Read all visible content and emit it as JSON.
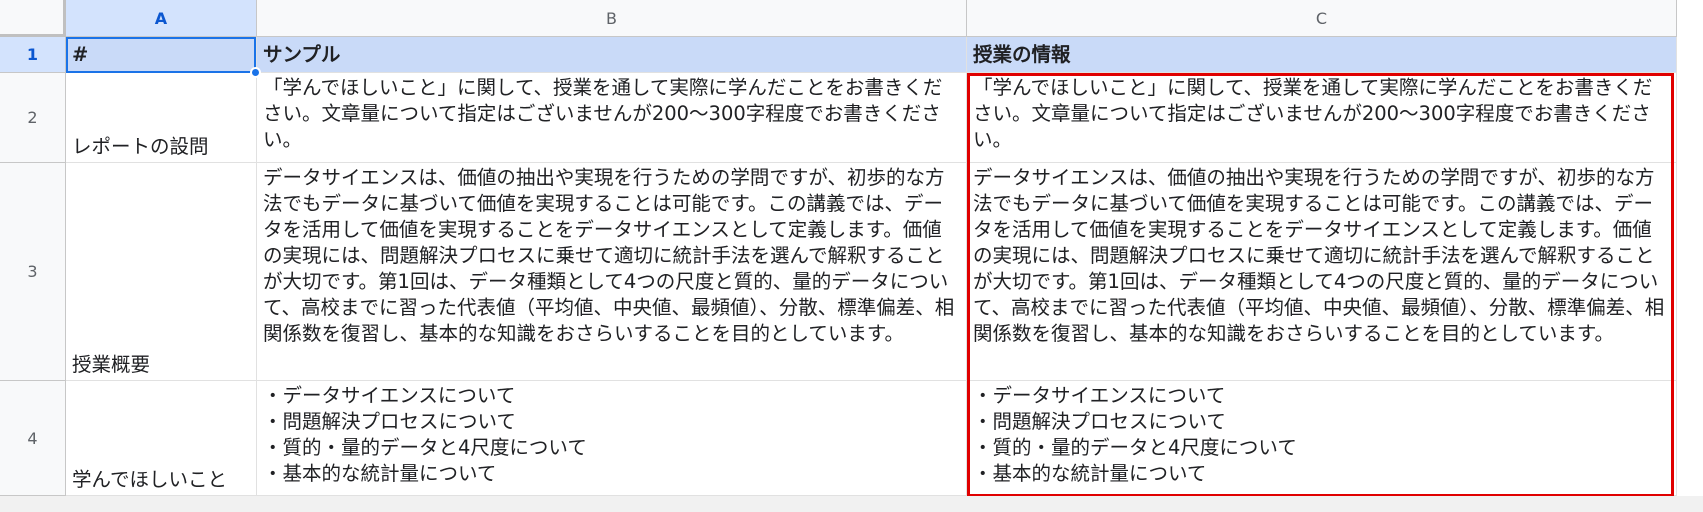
{
  "columns": [
    "A",
    "B",
    "C"
  ],
  "row_numbers": [
    "1",
    "2",
    "3",
    "4"
  ],
  "header_row": {
    "a": "#",
    "b": "サンプル",
    "c": "授業の情報"
  },
  "rows": [
    {
      "label": "レポートの設問",
      "sample": "「学んでほしいこと」に関して、授業を通して実際に学んだことをお書きください。文章量について指定はございませんが200〜300字程度でお書きください。",
      "info": "「学んでほしいこと」に関して、授業を通して実際に学んだことをお書きください。文章量について指定はございませんが200〜300字程度でお書きください。"
    },
    {
      "label": "授業概要",
      "sample": "データサイエンスは、価値の抽出や実現を行うための学問ですが、初歩的な方法でもデータに基づいて価値を実現することは可能です。この講義では、データを活用して価値を実現することをデータサイエンスとして定義します。価値の実現には、問題解決プロセスに乗せて適切に統計手法を選んで解釈することが大切です。第1回は、データ種類として4つの尺度と質的、量的データについて、高校までに習った代表値（平均値、中央値、最頻値）、分散、標準偏差、相関係数を復習し、基本的な知識をおさらいすることを目的としています。",
      "info": "データサイエンスは、価値の抽出や実現を行うための学問ですが、初歩的な方法でもデータに基づいて価値を実現することは可能です。この講義では、データを活用して価値を実現することをデータサイエンスとして定義します。価値の実現には、問題解決プロセスに乗せて適切に統計手法を選んで解釈することが大切です。第1回は、データ種類として4つの尺度と質的、量的データについて、高校までに習った代表値（平均値、中央値、最頻値）、分散、標準偏差、相関係数を復習し、基本的な知識をおさらいすることを目的としています。"
    },
    {
      "label": "学んでほしいこと",
      "sample": "・データサイエンスについて\n・問題解決プロセスについて\n・質的・量的データと4尺度について\n・基本的な統計量について",
      "info": "・データサイエンスについて\n・問題解決プロセスについて\n・質的・量的データと4尺度について\n・基本的な統計量について"
    }
  ],
  "colors": {
    "header_row_fill": "#c9daf8",
    "selection": "#1a73e8",
    "highlight_border": "#e00000"
  }
}
